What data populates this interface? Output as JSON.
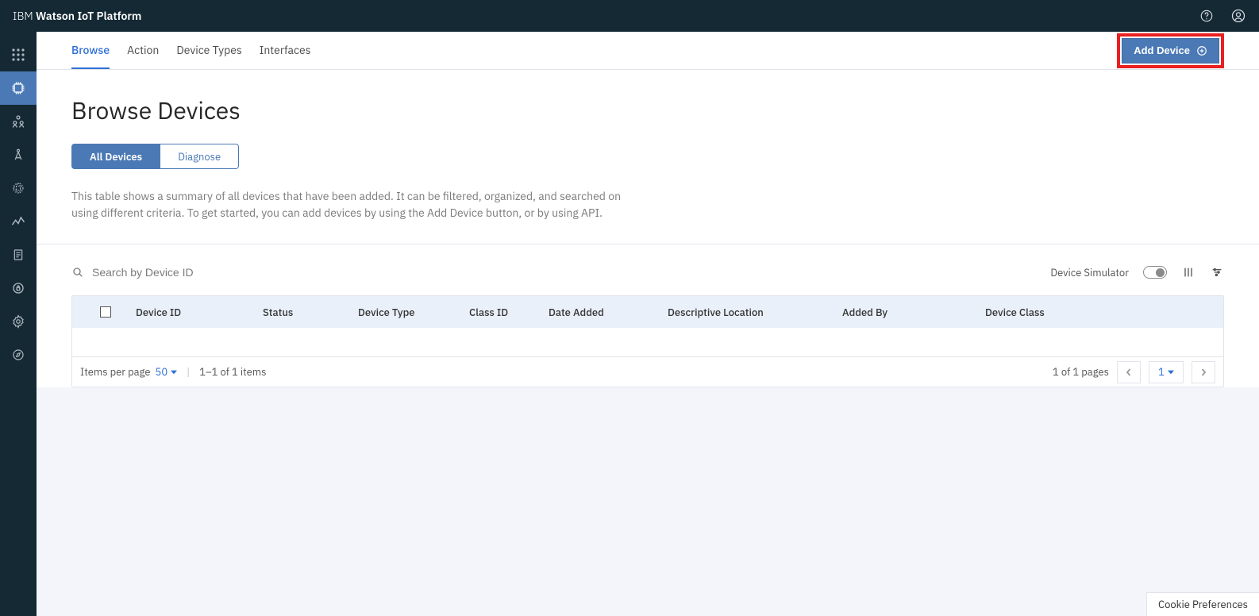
{
  "header": {
    "brand_prefix": "IBM ",
    "brand_bold": "Watson IoT Platform"
  },
  "tabs": {
    "browse": "Browse",
    "action": "Action",
    "device_types": "Device Types",
    "interfaces": "Interfaces"
  },
  "actions": {
    "add_device": "Add Device"
  },
  "page": {
    "title": "Browse Devices",
    "segment_all": "All Devices",
    "segment_diagnose": "Diagnose",
    "description": "This table shows a summary of all devices that have been added. It can be filtered, organized, and searched on using different criteria. To get started, you can add devices by using the Add Device button, or by using API."
  },
  "search": {
    "placeholder": "Search by Device ID"
  },
  "toolbar": {
    "simulator_label": "Device Simulator"
  },
  "table": {
    "headers": {
      "device_id": "Device ID",
      "status": "Status",
      "device_type": "Device Type",
      "class_id": "Class ID",
      "date_added": "Date Added",
      "descriptive_location": "Descriptive Location",
      "added_by": "Added By",
      "device_class": "Device Class"
    }
  },
  "pagination": {
    "items_per_page_label": "Items per page",
    "items_per_page_value": "50",
    "items_range": "1–1 of 1 items",
    "pages_range": "1 of 1 pages",
    "current_page": "1"
  },
  "footer": {
    "cookie_preferences": "Cookie Preferences"
  }
}
